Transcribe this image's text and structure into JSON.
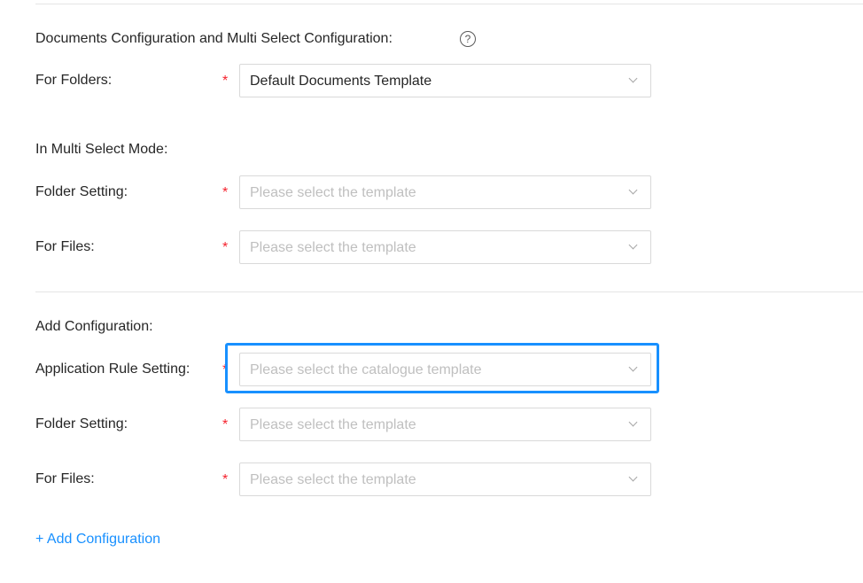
{
  "section1": {
    "title": "Documents Configuration and Multi Select Configuration:",
    "help_icon": "?",
    "for_folders": {
      "label": "For Folders:",
      "required": "*",
      "value": "Default Documents Template"
    }
  },
  "multi_select": {
    "heading": "In Multi Select Mode:",
    "folder_setting": {
      "label": "Folder Setting:",
      "required": "*",
      "placeholder": "Please select the template"
    },
    "for_files": {
      "label": "For Files:",
      "required": "*",
      "placeholder": "Please select the template"
    }
  },
  "add_config": {
    "heading": "Add Configuration:",
    "application_rule": {
      "label": "Application Rule Setting:",
      "required": "*",
      "placeholder": "Please select the catalogue template",
      "focused": true
    },
    "folder_setting": {
      "label": "Folder Setting:",
      "required": "*",
      "placeholder": "Please select the template"
    },
    "for_files": {
      "label": "For Files:",
      "required": "*",
      "placeholder": "Please select the template"
    }
  },
  "add_configuration_link": "+ Add Configuration",
  "colors": {
    "accent": "#1890ff",
    "required": "#f5222d",
    "placeholder": "#bfbfbf",
    "border": "#d9d9d9"
  },
  "icons": {
    "help": "question-circle-icon",
    "dropdown": "chevron-down-icon"
  }
}
